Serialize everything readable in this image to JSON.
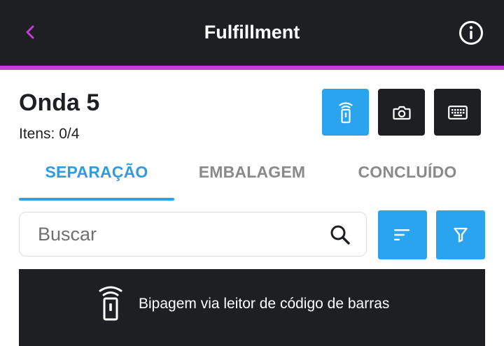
{
  "header": {
    "title": "Fulfillment",
    "back_icon": "chevron-left-icon",
    "info_icon": "info-circle-icon",
    "accent_color": "#c43ed6",
    "background_color": "#1e1f22"
  },
  "wave": {
    "title": "Onda 5",
    "items_label": "Itens: 0/4"
  },
  "input_modes": [
    {
      "name": "scanner",
      "icon": "barcode-scanner-icon",
      "active": true
    },
    {
      "name": "camera",
      "icon": "camera-icon",
      "active": false
    },
    {
      "name": "keyboard",
      "icon": "keyboard-icon",
      "active": false
    }
  ],
  "tabs": [
    {
      "label": "SEPARAÇÃO",
      "active": true
    },
    {
      "label": "EMBALAGEM",
      "active": false
    },
    {
      "label": "CONCLUÍDO",
      "active": false
    }
  ],
  "search": {
    "placeholder": "Buscar",
    "value": ""
  },
  "toolbar": {
    "sort_icon": "sort-icon",
    "filter_icon": "filter-icon",
    "button_color": "#2ba4f0"
  },
  "scanner_banner": {
    "text": "Bipagem via leitor de código de barras",
    "icon": "barcode-scanner-icon"
  }
}
